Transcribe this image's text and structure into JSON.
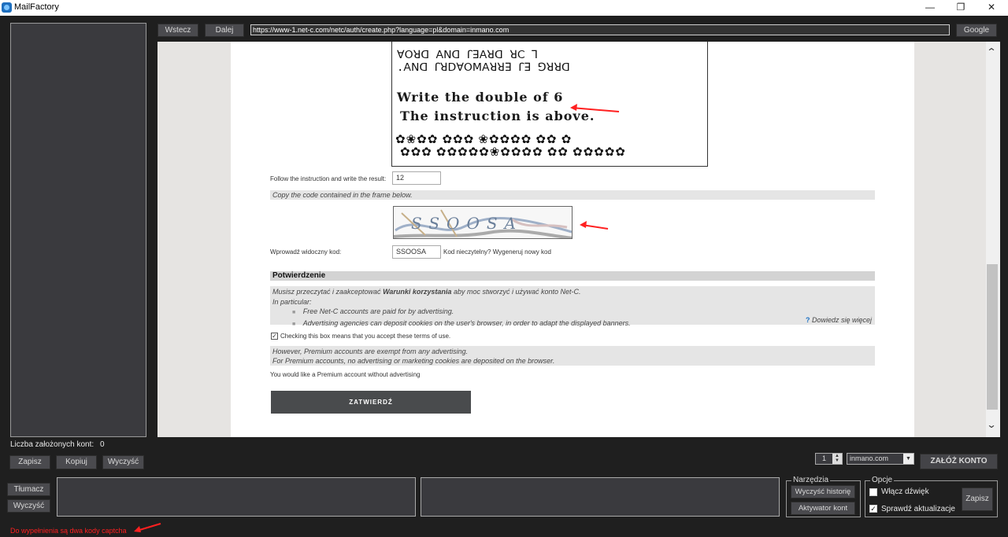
{
  "window": {
    "title": "MailFactory",
    "min_glyph": "—",
    "max_glyph": "❐",
    "close_glyph": "✕"
  },
  "nav": {
    "back_label": "Wstecz",
    "forward_label": "Dalej",
    "url": "https://www-1.net-c.com/netc/auth/create.php?language=pl&domain=inmano.com",
    "google_label": "Google"
  },
  "captcha_text": {
    "line1": "ꓯꓳꓤꓷ ꓮꓠꓷ ꓩꓱꓮꓤꓷ ꓤꓚ Ꞁ",
    "line2": ".ꓮꓠꓷ ꓩꓤꓓꓯꓳꓟꓮꓤꓤꓱ ꓩꓱ ꓨꓤꓤꓷ",
    "line3": "Write the double of 6",
    "line4": "The instruction is above.",
    "line5": "✿❀✿✿ ✿✿✿ ❀✿✿✿✿ ✿✿ ✿",
    "line6": "✿✿✿ ✿✿✿✿✿❀✿✿✿✿ ✿✿ ✿✿✿✿✿"
  },
  "form": {
    "instruction_label": "Follow the instruction and write the result:",
    "instruction_value": "12",
    "copy_code_text": "Copy the code contained in the frame below.",
    "captcha2_text": "SSOOSA",
    "visible_code_label": "Wprowadź widoczny kod:",
    "visible_code_value": "SSOOSA",
    "regen_text": "Kod nieczytelny? Wygeneruj nowy kod",
    "confirm_title": "Potwierdzenie",
    "terms_pre": "Musisz przeczytać i zaakceptować ",
    "terms_link": "Warunki korzystania",
    "terms_post": " aby moc stworzyć i używać konto Net-C.",
    "in_particular": "In particular:",
    "bullet1": "Free Net-C accounts are paid for by advertising.",
    "bullet2": "Advertising agencies can deposit cookies on the user's browser, in order to adapt the displayed banners.",
    "learn_more_icon": "?",
    "learn_more": "Dowiedz się więcej",
    "checkbox_text": "Checking this box means that you accept these terms of use.",
    "premium1": "However, Premium accounts are exempt from any advertising.",
    "premium2": "For Premium accounts, no advertising or marketing cookies are deposited on the browser.",
    "premium_question": "You would like a Premium account without advertising",
    "submit_label": "ZATWIERDŹ"
  },
  "left": {
    "accounts_label": "Liczba założonych kont:",
    "accounts_value": "0",
    "save_label": "Zapisz",
    "copy_label": "Kopiuj",
    "clear_label": "Wyczyść"
  },
  "right_controls": {
    "count_value": "1",
    "domain_value": "inmano.com",
    "create_label": "ZAŁÓŻ KONTO"
  },
  "bottom": {
    "translate_label": "Tłumacz",
    "clear_label": "Wyczyść",
    "tools_title": "Narzędzia",
    "clear_history_label": "Wyczyść historię",
    "activator_label": "Aktywator kont",
    "options_title": "Opcje",
    "sound_label": "Włącz dźwięk",
    "updates_label": "Sprawdź aktualizacje",
    "options_save_label": "Zapisz"
  },
  "status_note": "Do wypełnienia są dwa kody captcha",
  "colors": {
    "annotation_red": "#ff2020",
    "app_bg": "#1f1f1f",
    "panel": "#3a3a3e"
  }
}
